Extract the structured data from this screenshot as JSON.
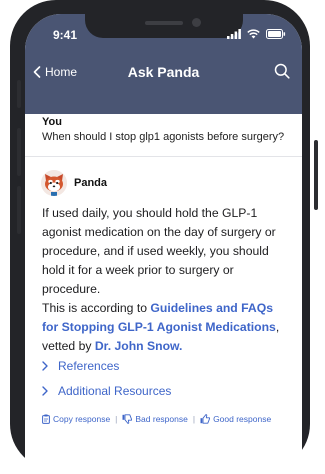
{
  "status_bar": {
    "time": "9:41"
  },
  "nav": {
    "back_label": "Home",
    "title": "Ask Panda"
  },
  "question": {
    "author": "You",
    "text": "When should I stop glp1 agonists before surgery?"
  },
  "answer": {
    "author": "Panda",
    "text": "If used daily, you should hold the GLP-1 agonist medication on the day of surgery or procedure, and if used weekly, you should hold it for a week prior to surgery or procedure.",
    "citation": {
      "prefix": "This is according to ",
      "source": "Guidelines and FAQs for Stopping GLP-1 Agonist Medications",
      "middle": ", vetted by ",
      "vetter": "Dr. John Snow."
    }
  },
  "expanders": {
    "references": "References",
    "additional": "Additional Resources"
  },
  "feedback": {
    "copy": "Copy response",
    "bad": "Bad response",
    "good": "Good response"
  },
  "colors": {
    "header": "#4a5573",
    "link": "#3f66c9",
    "phone_body": "#232428"
  }
}
